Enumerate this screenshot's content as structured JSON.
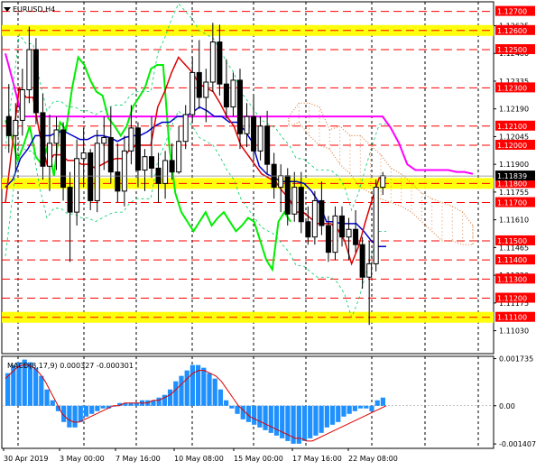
{
  "chart_data": [
    {
      "type": "candlestick",
      "title": "EURUSD,H4",
      "ylim": [
        1.1091,
        1.1275
      ],
      "price_scale_ticks": [
        "1.12625",
        "1.12480",
        "1.12335",
        "1.12190",
        "1.12045",
        "1.11900",
        "1.11755",
        "1.11610",
        "1.11465",
        "1.11320",
        "1.11175",
        "1.11030"
      ],
      "levels": [
        {
          "value": 1.127,
          "label": "1.12700",
          "color": "#ff0000",
          "highlight": false
        },
        {
          "value": 1.126,
          "label": "1.12600",
          "color": "#ff0000",
          "highlight": true
        },
        {
          "value": 1.125,
          "label": "1.12500",
          "color": "#ff0000",
          "highlight": false
        },
        {
          "value": 1.123,
          "label": "1.12300",
          "color": "#ff0000",
          "highlight": false
        },
        {
          "value": 1.121,
          "label": "1.12100",
          "color": "#ff0000",
          "highlight": false
        },
        {
          "value": 1.12,
          "label": "1.12000",
          "color": "#ff0000",
          "highlight": false
        },
        {
          "value": 1.118,
          "label": "1.11800",
          "color": "#ff0000",
          "highlight": true
        },
        {
          "value": 1.117,
          "label": "1.11700",
          "color": "#ff0000",
          "highlight": false
        },
        {
          "value": 1.115,
          "label": "1.11500",
          "color": "#ff0000",
          "highlight": false
        },
        {
          "value": 1.114,
          "label": "1.11400",
          "color": "#ff0000",
          "highlight": false
        },
        {
          "value": 1.113,
          "label": "1.11300",
          "color": "#ff0000",
          "highlight": false
        },
        {
          "value": 1.112,
          "label": "1.11200",
          "color": "#ff0000",
          "highlight": false
        },
        {
          "value": 1.111,
          "label": "1.11100",
          "color": "#ff0000",
          "highlight": true
        }
      ],
      "current_price": {
        "value": 1.11839,
        "label": "1.11839"
      },
      "x_tick_labels": [
        "30 Apr 2019",
        "3 May 00:00",
        "7 May 16:00",
        "10 May 08:00",
        "15 May 00:00",
        "17 May 16:00",
        "22 May 08:00"
      ],
      "candles_ohlc": [
        [
          1.1215,
          1.1232,
          1.1196,
          1.1205
        ],
        [
          1.1205,
          1.1222,
          1.1186,
          1.1213
        ],
        [
          1.1213,
          1.124,
          1.1205,
          1.1229
        ],
        [
          1.1229,
          1.1262,
          1.1222,
          1.125
        ],
        [
          1.125,
          1.1256,
          1.1211,
          1.1217
        ],
        [
          1.1217,
          1.1227,
          1.1182,
          1.1189
        ],
        [
          1.1189,
          1.1216,
          1.1176,
          1.1201
        ],
        [
          1.1201,
          1.1215,
          1.1187,
          1.1208
        ],
        [
          1.1208,
          1.1212,
          1.1171,
          1.1178
        ],
        [
          1.1178,
          1.1186,
          1.1139,
          1.1165
        ],
        [
          1.1165,
          1.1203,
          1.1158,
          1.1193
        ],
        [
          1.1193,
          1.1209,
          1.1178,
          1.1196
        ],
        [
          1.1196,
          1.1198,
          1.1166,
          1.1171
        ],
        [
          1.1171,
          1.1208,
          1.1165,
          1.1201
        ],
        [
          1.1201,
          1.1215,
          1.1187,
          1.1204
        ],
        [
          1.1204,
          1.122,
          1.118,
          1.1186
        ],
        [
          1.1186,
          1.1201,
          1.117,
          1.1176
        ],
        [
          1.1176,
          1.1205,
          1.1168,
          1.1197
        ],
        [
          1.1197,
          1.1221,
          1.119,
          1.1209
        ],
        [
          1.1209,
          1.1212,
          1.1178,
          1.1187
        ],
        [
          1.1187,
          1.1198,
          1.1176,
          1.1194
        ],
        [
          1.1194,
          1.1215,
          1.1183,
          1.1188
        ],
        [
          1.1188,
          1.1196,
          1.117,
          1.118
        ],
        [
          1.118,
          1.1197,
          1.1172,
          1.1192
        ],
        [
          1.1192,
          1.1201,
          1.1182,
          1.1186
        ],
        [
          1.1186,
          1.121,
          1.1185,
          1.1202
        ],
        [
          1.1202,
          1.1221,
          1.1198,
          1.1216
        ],
        [
          1.1216,
          1.1246,
          1.1212,
          1.1238
        ],
        [
          1.1238,
          1.1255,
          1.1219,
          1.1225
        ],
        [
          1.1225,
          1.124,
          1.1212,
          1.1233
        ],
        [
          1.1233,
          1.1264,
          1.1228,
          1.1254
        ],
        [
          1.1254,
          1.1263,
          1.1226,
          1.1232
        ],
        [
          1.1232,
          1.1245,
          1.1214,
          1.122
        ],
        [
          1.122,
          1.1238,
          1.1215,
          1.1234
        ],
        [
          1.1234,
          1.124,
          1.1198,
          1.1206
        ],
        [
          1.1206,
          1.1222,
          1.1199,
          1.1215
        ],
        [
          1.1215,
          1.1226,
          1.1192,
          1.1197
        ],
        [
          1.1197,
          1.1215,
          1.1192,
          1.121
        ],
        [
          1.121,
          1.1218,
          1.1185,
          1.119
        ],
        [
          1.119,
          1.1196,
          1.1172,
          1.1178
        ],
        [
          1.1178,
          1.119,
          1.1165,
          1.1184
        ],
        [
          1.1184,
          1.1188,
          1.1158,
          1.1164
        ],
        [
          1.1164,
          1.1186,
          1.116,
          1.1178
        ],
        [
          1.1178,
          1.1186,
          1.1154,
          1.116
        ],
        [
          1.116,
          1.1168,
          1.1148,
          1.1152
        ],
        [
          1.1152,
          1.1176,
          1.1148,
          1.1171
        ],
        [
          1.1171,
          1.1181,
          1.1153,
          1.1158
        ],
        [
          1.1158,
          1.1163,
          1.1139,
          1.1144
        ],
        [
          1.1144,
          1.1168,
          1.114,
          1.1163
        ],
        [
          1.1163,
          1.1168,
          1.1147,
          1.1152
        ],
        [
          1.1152,
          1.1162,
          1.114,
          1.1156
        ],
        [
          1.1156,
          1.1166,
          1.1144,
          1.1148
        ],
        [
          1.1148,
          1.1152,
          1.1125,
          1.1131
        ],
        [
          1.1131,
          1.115,
          1.1106,
          1.1138
        ],
        [
          1.1138,
          1.1182,
          1.1134,
          1.1178
        ],
        [
          1.1178,
          1.1186,
          1.1174,
          1.1184
        ]
      ],
      "indicators": {
        "ma_magenta": [
          1.1248,
          1.1232,
          1.1215,
          1.1215,
          1.1215,
          1.1215,
          1.1215,
          1.1215,
          1.1215,
          1.1215,
          1.1215,
          1.1215,
          1.1215,
          1.1215,
          1.1215,
          1.1215,
          1.1215,
          1.1215,
          1.1215,
          1.1215,
          1.1215,
          1.1215,
          1.1215,
          1.1215,
          1.1215,
          1.1215,
          1.1215,
          1.1215,
          1.1215,
          1.1215,
          1.1215,
          1.1215,
          1.1215,
          1.1215,
          1.1215,
          1.1215,
          1.1215,
          1.1215,
          1.1215,
          1.1215,
          1.1215,
          1.1215,
          1.1215,
          1.1215,
          1.1215,
          1.1215,
          1.1215,
          1.1209,
          1.1201,
          1.119,
          1.1187,
          1.1187,
          1.1187,
          1.1187,
          1.1187,
          1.1186,
          1.1186,
          1.1185
        ],
        "ma_blue": [
          1.1178,
          1.1182,
          1.1193,
          1.1198,
          1.1205,
          1.1205,
          1.1205,
          1.1207,
          1.1207,
          1.1205,
          1.1203,
          1.1203,
          1.1205,
          1.1205,
          1.1204,
          1.1202,
          1.1204,
          1.1205,
          1.1205,
          1.1207,
          1.121,
          1.1212,
          1.1212,
          1.1215,
          1.1215,
          1.1217,
          1.122,
          1.1218,
          1.1215,
          1.1215,
          1.1212,
          1.1212,
          1.1208,
          1.1202,
          1.1189,
          1.1185,
          1.1183,
          1.1181,
          1.1181,
          1.1181,
          1.118,
          1.1176,
          1.117,
          1.116,
          1.116,
          1.1159,
          1.1159,
          1.1159,
          1.1155,
          1.115,
          1.1147,
          1.1147
        ],
        "ma_red": [
          1.117,
          1.12,
          1.123,
          1.1225,
          1.1225,
          1.1205,
          1.119,
          1.1195,
          1.1195,
          1.1192,
          1.1192,
          1.119,
          1.119,
          1.1188,
          1.119,
          1.1192,
          1.1193,
          1.1193,
          1.1198,
          1.12,
          1.12,
          1.12,
          1.122,
          1.1228,
          1.1238,
          1.1246,
          1.1242,
          1.1238,
          1.1232,
          1.123,
          1.1228,
          1.1222,
          1.1215,
          1.121,
          1.12,
          1.1195,
          1.119,
          1.1185,
          1.1183,
          1.1181,
          1.1176,
          1.1172,
          1.1165,
          1.1165,
          1.1162,
          1.1159,
          1.1159,
          1.1159,
          1.1156,
          1.115,
          1.1138,
          1.1147,
          1.116,
          1.1172,
          1.1183,
          1.1183
        ],
        "ma_green": [
          1.1213,
          1.1205,
          1.1192,
          1.12,
          1.121,
          1.1194,
          1.119,
          1.12,
          1.1184,
          1.1212,
          1.1208,
          1.123,
          1.1246,
          1.1242,
          1.1234,
          1.1228,
          1.1226,
          1.1214,
          1.121,
          1.1205,
          1.121,
          1.122,
          1.1225,
          1.123,
          1.124,
          1.1242,
          1.1242,
          1.12,
          1.1175,
          1.1165,
          1.116,
          1.1155,
          1.116,
          1.1165,
          1.1158,
          1.1162,
          1.1165,
          1.116,
          1.1155,
          1.1158,
          1.1162,
          1.116,
          1.115,
          1.114,
          1.1135,
          1.116,
          1.1165,
          1.116
        ]
      },
      "ichimoku_cloud": {
        "upper": [
          1.1215,
          1.1222,
          1.1222,
          1.122,
          1.1208,
          1.121,
          1.1205,
          1.1205,
          1.12,
          1.1195,
          1.1188,
          1.1185,
          1.118,
          1.1175,
          1.1172,
          1.117,
          1.1168,
          1.1165,
          1.1158
        ],
        "lower": [
          1.121,
          1.1212,
          1.1205,
          1.12,
          1.1198,
          1.119,
          1.1185,
          1.1178,
          1.1175,
          1.1172,
          1.117,
          1.1168,
          1.1165,
          1.116,
          1.1155,
          1.115,
          1.115,
          1.1148,
          1.1148
        ]
      }
    },
    {
      "type": "bar",
      "title": "MACD(8,17,9) 0.000327 -0.000301",
      "ylim": [
        -0.00157,
        0.00182
      ],
      "price_scale_ticks": [
        "0.001735",
        "0.00",
        "-0.001407"
      ],
      "histogram": [
        0.0012,
        0.0015,
        0.0016,
        0.0017,
        0.0016,
        0.0014,
        0.0011,
        0.0006,
        0.0002,
        -0.0002,
        -0.0006,
        -0.0008,
        -0.0008,
        -0.0006,
        -0.0004,
        -0.0003,
        -0.0002,
        -0.0001,
        -0.0001,
        0.0,
        0.0001,
        0.0001,
        0.0001,
        0.0001,
        0.0002,
        0.0002,
        0.0002,
        0.0003,
        0.0004,
        0.0006,
        0.0009,
        0.0011,
        0.0013,
        0.0015,
        0.0015,
        0.0014,
        0.0012,
        0.001,
        0.0006,
        0.0002,
        -0.0001,
        -0.0003,
        -0.0005,
        -0.0006,
        -0.0007,
        -0.0008,
        -0.0009,
        -0.001,
        -0.0011,
        -0.0012,
        -0.0013,
        -0.0014,
        -0.0014,
        -0.0013,
        -0.0012,
        -0.0011,
        -0.001,
        -0.0008,
        -0.0007,
        -0.0006,
        -0.0004,
        -0.0003,
        -0.0002,
        -0.0001,
        -0.0001,
        -0.0002,
        0.0002,
        0.0003
      ],
      "signal": [
        0.001,
        0.0012,
        0.0014,
        0.0015,
        0.0015,
        0.0014,
        0.0012,
        0.0009,
        0.0005,
        0.0001,
        -0.0003,
        -0.0005,
        -0.0006,
        -0.0006,
        -0.0005,
        -0.0004,
        -0.0003,
        -0.0002,
        -0.0001,
        0.0,
        0.0,
        0.0001,
        0.0001,
        0.0001,
        0.0001,
        0.0001,
        0.0002,
        0.0002,
        0.0003,
        0.0004,
        0.0006,
        0.0008,
        0.001,
        0.0012,
        0.0013,
        0.0013,
        0.0012,
        0.0011,
        0.0009,
        0.0006,
        0.0003,
        0.0,
        -0.0002,
        -0.0004,
        -0.0005,
        -0.0006,
        -0.0007,
        -0.0008,
        -0.0009,
        -0.001,
        -0.0011,
        -0.0012,
        -0.0012,
        -0.0013,
        -0.0013,
        -0.0012,
        -0.0011,
        -0.001,
        -0.0009,
        -0.0008,
        -0.0007,
        -0.0006,
        -0.0005,
        -0.0004,
        -0.0003,
        -0.0002,
        -0.0001,
        0.0
      ]
    }
  ],
  "colors": {
    "candle": "#000000",
    "level_line": "#ff0000",
    "highlight_band": "#ffff00",
    "ma_magenta": "#ff00ff",
    "ma_blue": "#0000cc",
    "ma_red": "#dd0000",
    "ma_green": "#00ee00",
    "bands": "#00cc66",
    "cloud": "#d2691e",
    "macd_hist": "#1e90ff",
    "macd_signal": "#dd0000",
    "price_tag": "#000000"
  }
}
